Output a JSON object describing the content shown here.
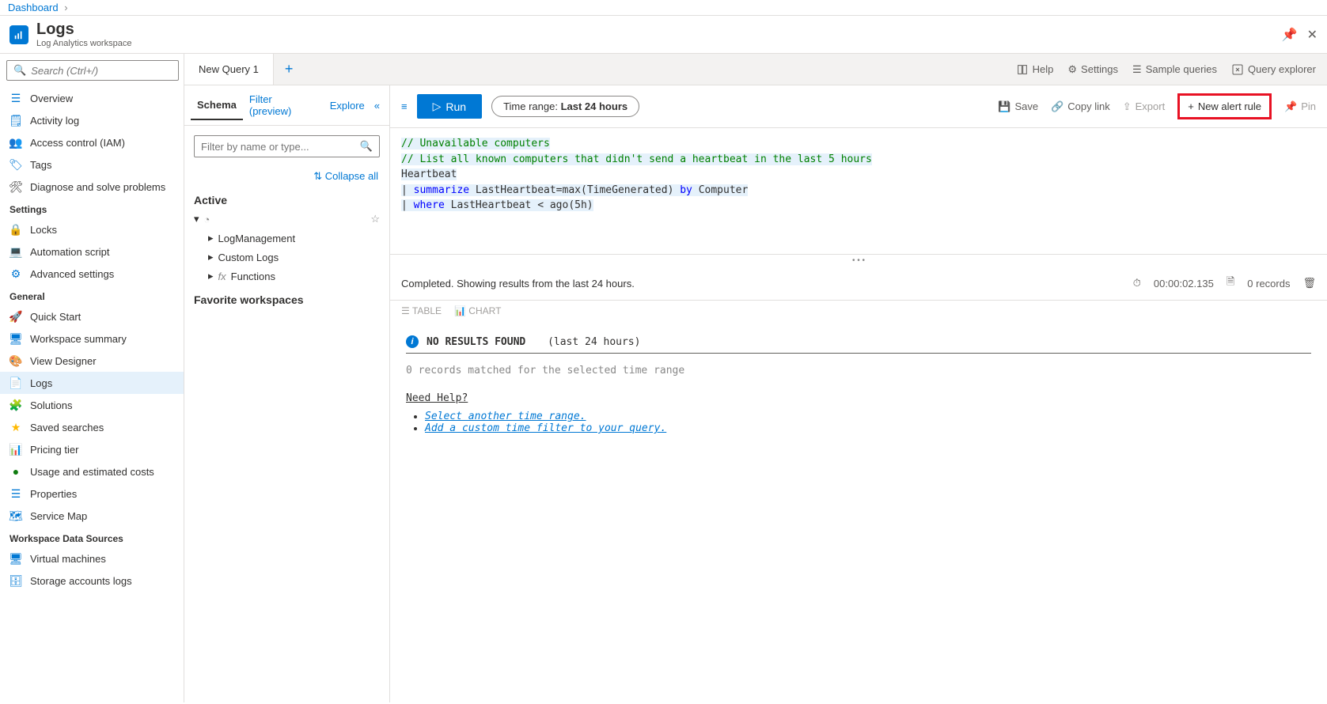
{
  "breadcrumb": {
    "item": "Dashboard"
  },
  "header": {
    "title": "Logs",
    "subtitle": "Log Analytics workspace"
  },
  "sidebar": {
    "search_placeholder": "Search (Ctrl+/)",
    "items_top": [
      {
        "label": "Overview"
      },
      {
        "label": "Activity log"
      },
      {
        "label": "Access control (IAM)"
      },
      {
        "label": "Tags"
      },
      {
        "label": "Diagnose and solve problems"
      }
    ],
    "section_settings": "Settings",
    "items_settings": [
      {
        "label": "Locks"
      },
      {
        "label": "Automation script"
      },
      {
        "label": "Advanced settings"
      }
    ],
    "section_general": "General",
    "items_general": [
      {
        "label": "Quick Start"
      },
      {
        "label": "Workspace summary"
      },
      {
        "label": "View Designer"
      },
      {
        "label": "Logs",
        "active": true
      },
      {
        "label": "Solutions"
      },
      {
        "label": "Saved searches"
      },
      {
        "label": "Pricing tier"
      },
      {
        "label": "Usage and estimated costs"
      },
      {
        "label": "Properties"
      },
      {
        "label": "Service Map"
      }
    ],
    "section_data": "Workspace Data Sources",
    "items_data": [
      {
        "label": "Virtual machines"
      },
      {
        "label": "Storage accounts logs"
      }
    ]
  },
  "schema": {
    "tabs": {
      "schema": "Schema",
      "filter": "Filter (preview)",
      "explore": "Explore"
    },
    "filter_placeholder": "Filter by name or type...",
    "collapse_all": "Collapse all",
    "active": "Active",
    "tree": [
      {
        "label": "LogManagement"
      },
      {
        "label": "Custom Logs"
      },
      {
        "label": "Functions"
      }
    ],
    "favorites": "Favorite workspaces"
  },
  "tabs": {
    "tab1": "New Query 1"
  },
  "topbar": {
    "help": "Help",
    "settings": "Settings",
    "sample": "Sample queries",
    "explorer": "Query explorer"
  },
  "toolbar": {
    "run": "Run",
    "time_label": "Time range:",
    "time_val": "Last 24 hours",
    "save": "Save",
    "copy": "Copy link",
    "export": "Export",
    "alert": "New alert rule",
    "pin": "Pin"
  },
  "editor": {
    "l1": "// Unavailable computers",
    "l2": "// List all known computers that didn't send a heartbeat in the last 5 hours",
    "l3": "Heartbeat",
    "l4_kw": "summarize",
    "l4_rest": " LastHeartbeat=max(TimeGenerated) ",
    "l4_by": "by",
    "l4_comp": " Computer",
    "l5_kw": "where",
    "l5_rest": " LastHeartbeat < ago(5h)"
  },
  "results": {
    "status": "Completed. Showing results from the last 24 hours.",
    "duration": "00:00:02.135",
    "records": "0 records",
    "tab_table": "TABLE",
    "tab_chart": "CHART",
    "no_results": "NO RESULTS FOUND",
    "no_results_range": "(last 24 hours)",
    "zero_matched": "0 records matched for the selected time range",
    "need_help": "Need Help?",
    "help1": "Select another time range.",
    "help2": "Add a custom time filter to your query."
  }
}
